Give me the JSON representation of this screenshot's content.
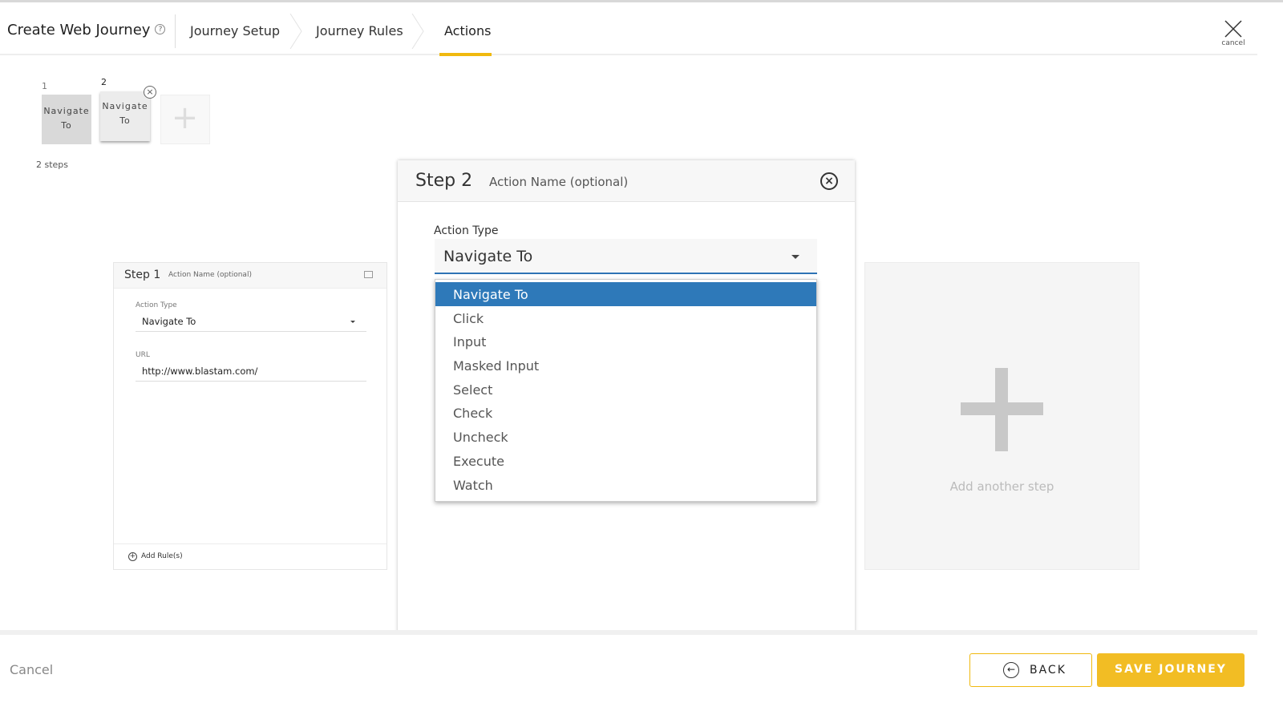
{
  "header": {
    "title": "Create Web Journey",
    "help_icon": "?",
    "crumbs": [
      "Journey Setup",
      "Journey Rules",
      "Actions"
    ],
    "active_crumb": "Actions",
    "cancel_label": "cancel"
  },
  "steps_bar": {
    "tiles": [
      {
        "num": "1",
        "label": "Navigate To"
      },
      {
        "num": "2",
        "label": "Navigate To"
      }
    ],
    "count": "2 steps"
  },
  "step1": {
    "title": "Step 1",
    "name_placeholder": "Action Name (optional)",
    "action_type_label": "Action Type",
    "action_type": "Navigate To",
    "url_label": "URL",
    "url": "http://www.blastam.com/",
    "add_rules": "Add Rule(s)"
  },
  "add_step": {
    "label": "Add another step"
  },
  "modal": {
    "title": "Step 2",
    "name_placeholder": "Action Name (optional)",
    "action_type_label": "Action Type",
    "action_type": "Navigate To",
    "options": [
      "Navigate To",
      "Click",
      "Input",
      "Masked Input",
      "Select",
      "Check",
      "Uncheck",
      "Execute",
      "Watch"
    ]
  },
  "footer": {
    "cancel": "Cancel",
    "back": "BACK",
    "save": "SAVE JOURNEY"
  },
  "colors": {
    "accent": "#f0b90f",
    "selected": "#2e79b9"
  }
}
